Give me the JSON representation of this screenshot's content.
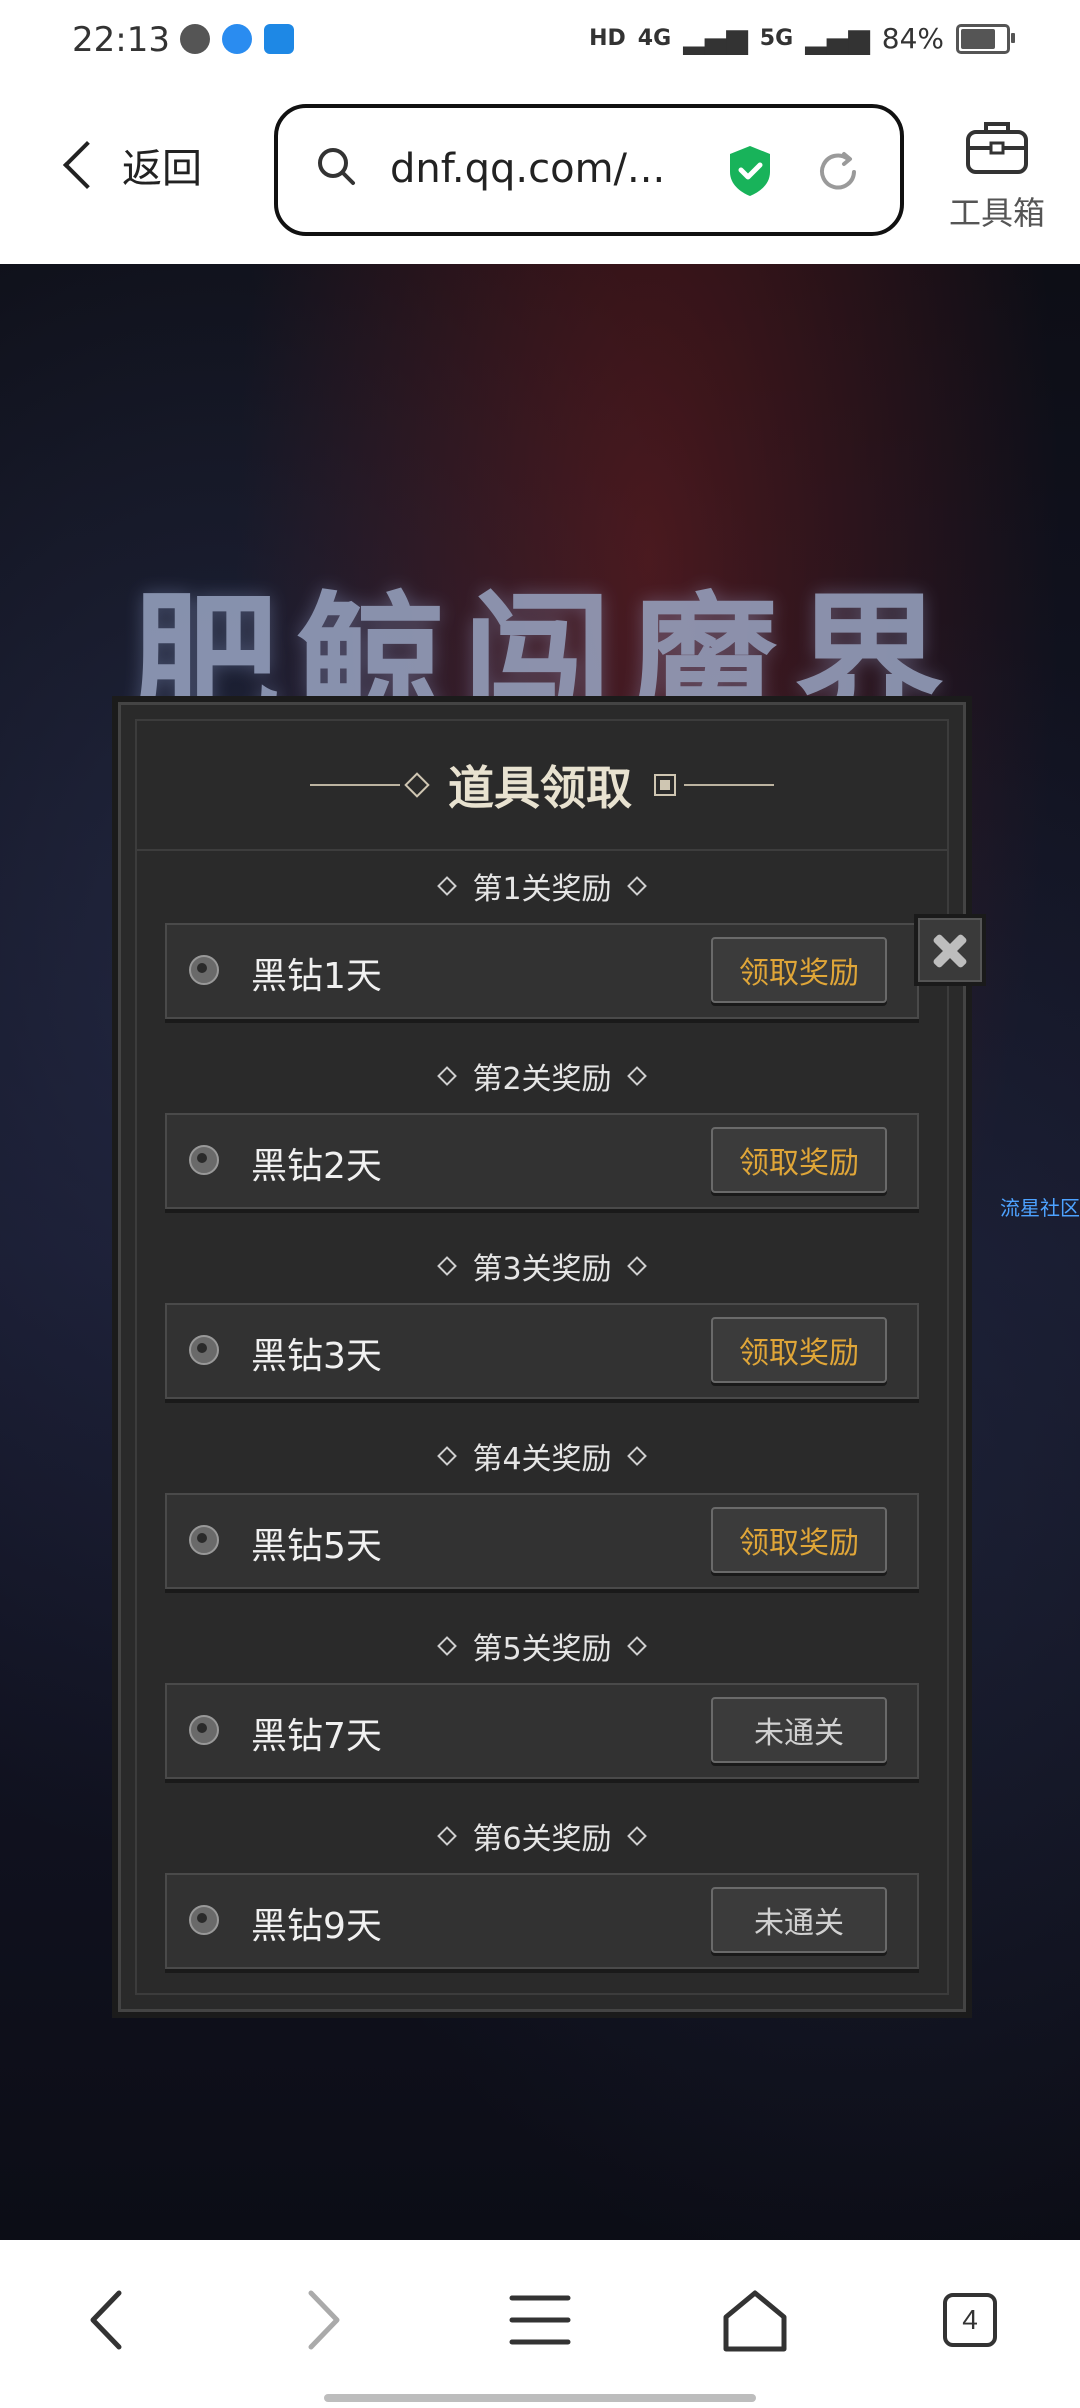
{
  "status_bar": {
    "time": "22:13",
    "network_1": "HD",
    "network_2": "4G",
    "network_3": "5G",
    "battery": "84%"
  },
  "browser": {
    "back_label": "返回",
    "url": "dnf.qq.com/...",
    "toolbox_label": "工具箱"
  },
  "page": {
    "banner_title": "肥鲸闯魔界",
    "side_link": "流星社区"
  },
  "modal": {
    "title": "道具领取",
    "sections": [
      {
        "title": "第1关奖励",
        "item": "黑钻1天",
        "button": "领取奖励",
        "state": "claimable"
      },
      {
        "title": "第2关奖励",
        "item": "黑钻2天",
        "button": "领取奖励",
        "state": "claimable"
      },
      {
        "title": "第3关奖励",
        "item": "黑钻3天",
        "button": "领取奖励",
        "state": "claimable"
      },
      {
        "title": "第4关奖励",
        "item": "黑钻5天",
        "button": "领取奖励",
        "state": "claimable"
      },
      {
        "title": "第5关奖励",
        "item": "黑钻7天",
        "button": "未通关",
        "state": "locked"
      },
      {
        "title": "第6关奖励",
        "item": "黑钻9天",
        "button": "未通关",
        "state": "locked"
      }
    ]
  },
  "bottom_nav": {
    "tab_count": "4"
  },
  "colors": {
    "accent_gold": "#e0a638",
    "shield_green": "#18b35a"
  }
}
